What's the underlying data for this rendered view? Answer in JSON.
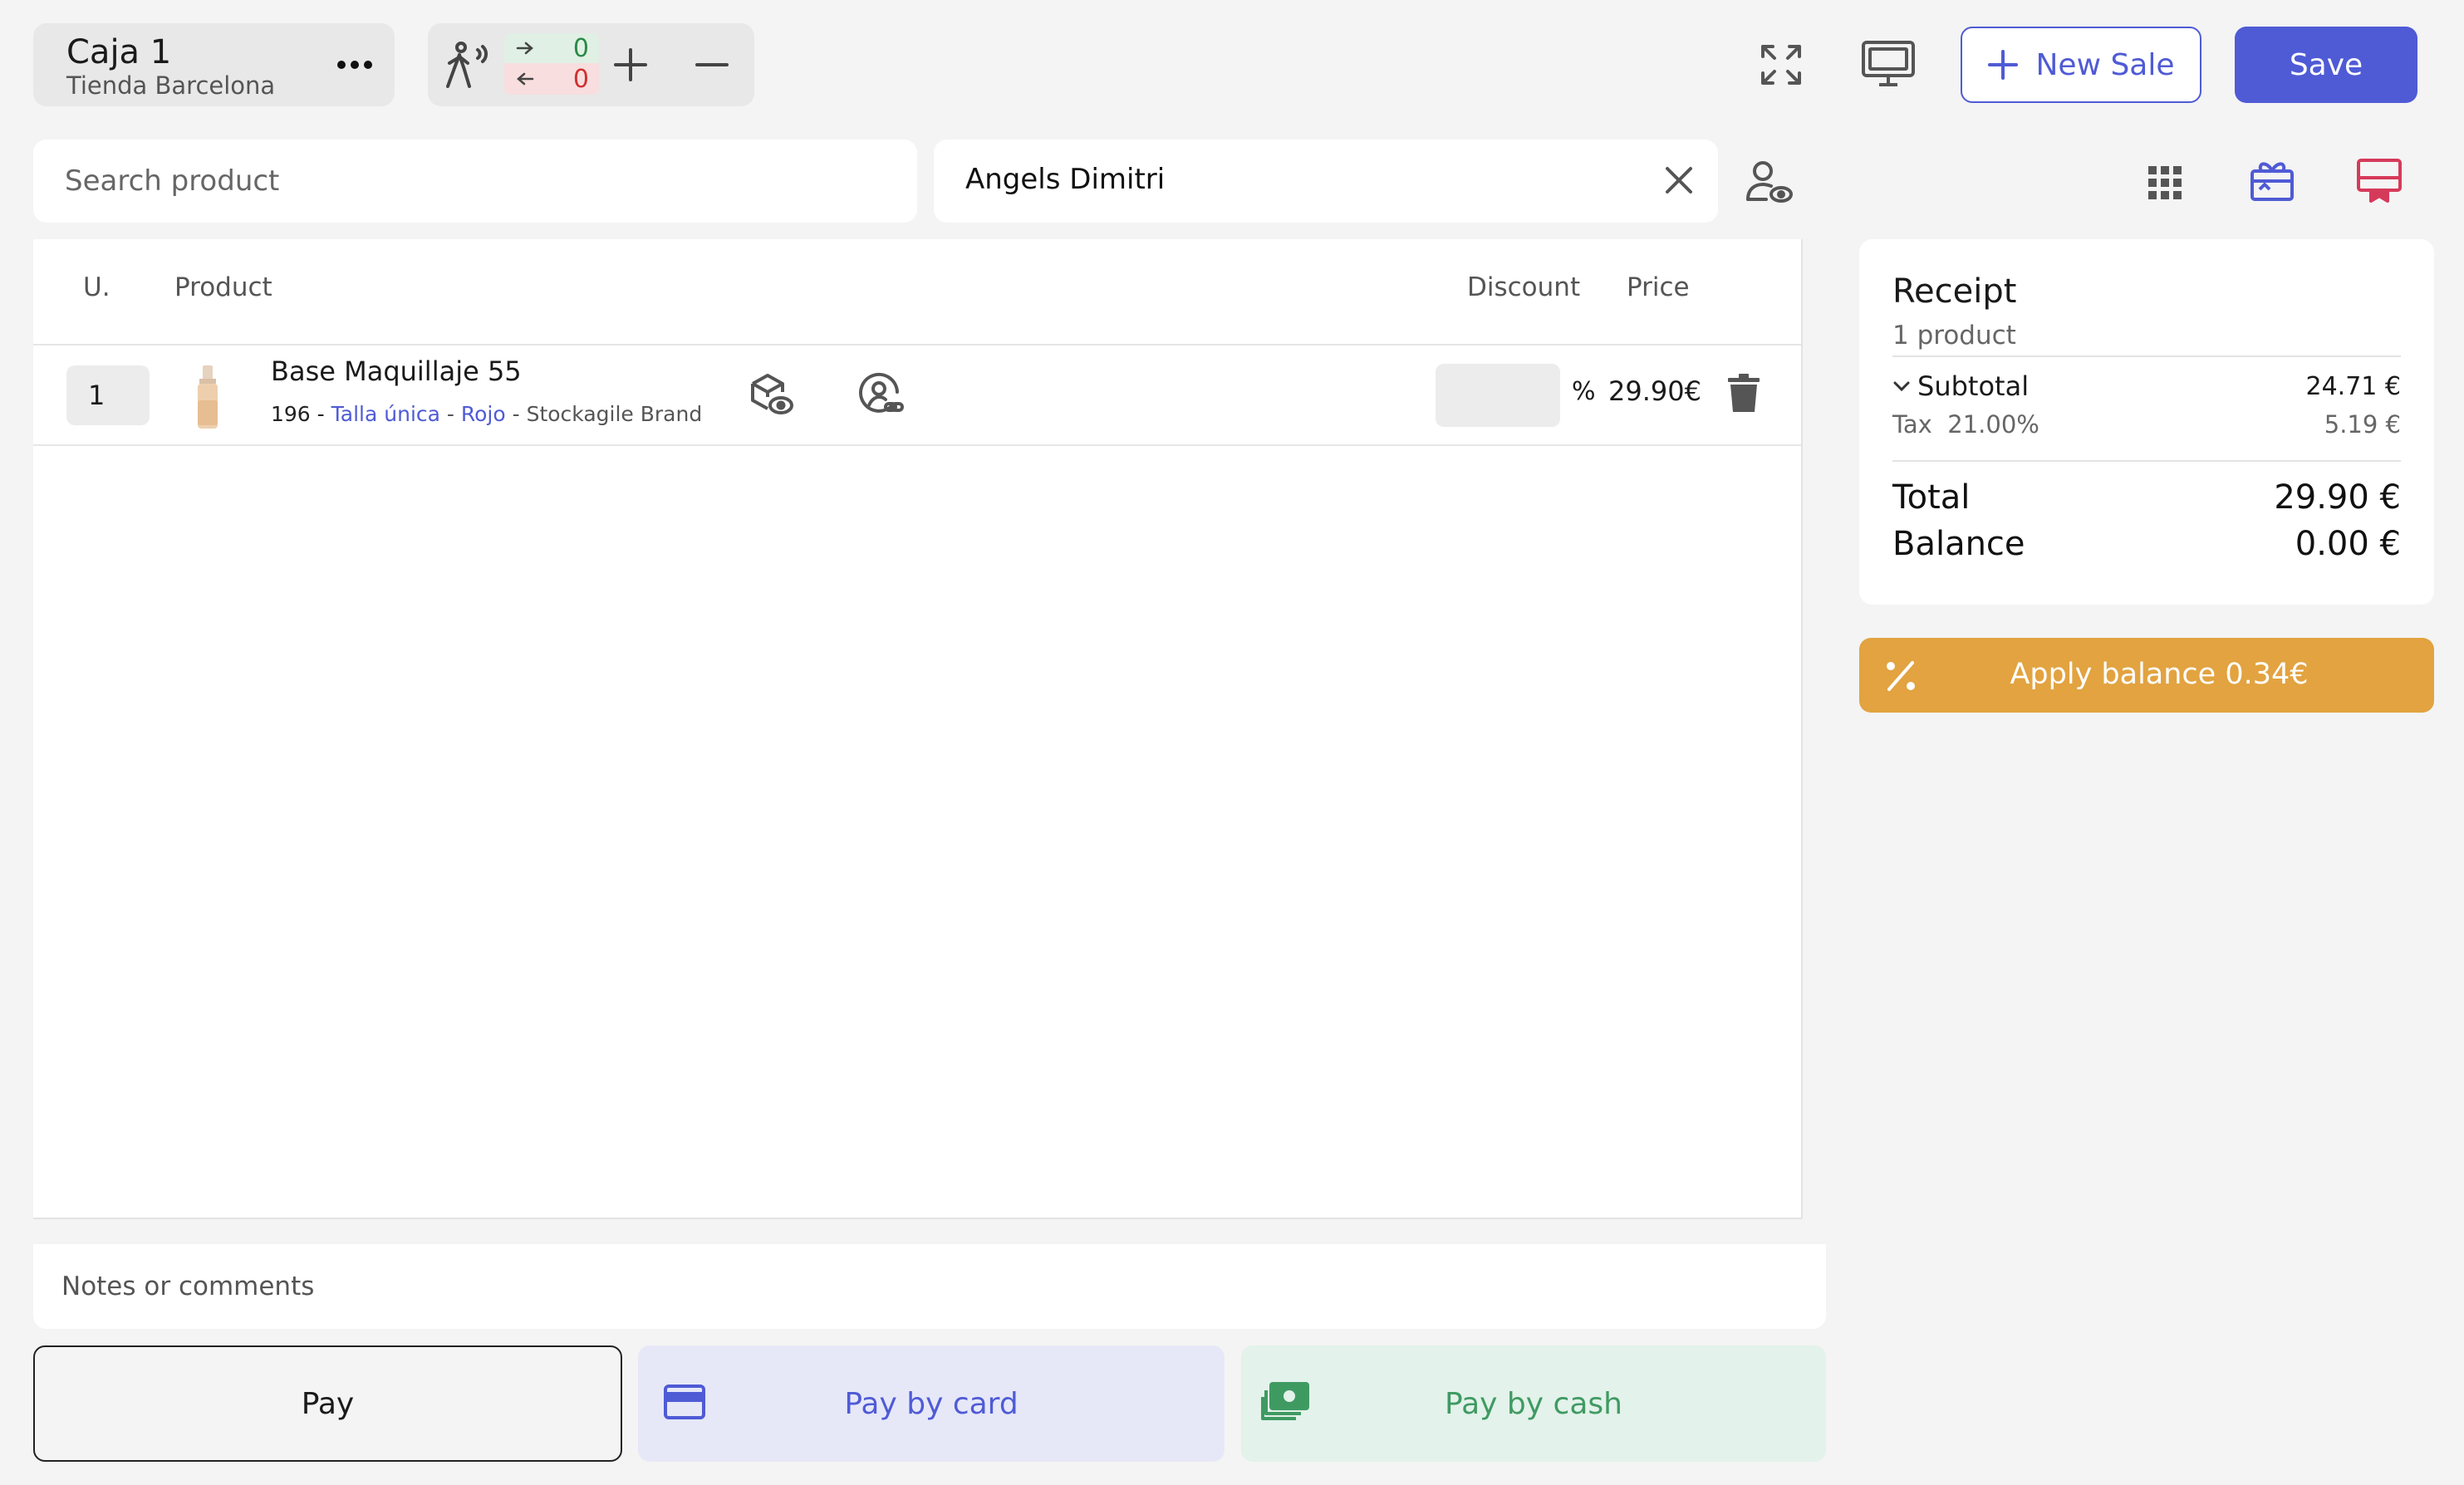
{
  "register": {
    "title": "Caja 1",
    "store": "Tienda Barcelona"
  },
  "traffic": {
    "in_count": "0",
    "out_count": "0"
  },
  "header": {
    "new_sale_label": "New Sale",
    "save_label": "Save"
  },
  "search": {
    "placeholder": "Search product",
    "value": ""
  },
  "customer": {
    "name": "Angels Dimitri"
  },
  "table": {
    "columns": {
      "units": "U.",
      "product": "Product",
      "discount": "Discount",
      "price": "Price"
    },
    "rows": [
      {
        "qty": "1",
        "name": "Base Maquillaje 55",
        "code": "196",
        "sep1": " - ",
        "size": "Talla única",
        "sep2": " - ",
        "color": "Rojo",
        "sep3": " - ",
        "brand": "Stockagile Brand",
        "discount": "",
        "percent_symbol": "%",
        "price": "29.90€"
      }
    ]
  },
  "notes": {
    "placeholder": "Notes or comments"
  },
  "payment": {
    "pay_label": "Pay",
    "card_label": "Pay by card",
    "cash_label": "Pay by cash"
  },
  "receipt": {
    "title": "Receipt",
    "count": "1 product",
    "subtotal_label": "Subtotal",
    "subtotal_value": "24.71 €",
    "tax_label": "Tax  21.00%",
    "tax_value": "5.19 €",
    "total_label": "Total",
    "total_value": "29.90 €",
    "balance_label": "Balance",
    "balance_value": "0.00 €"
  },
  "apply_balance": {
    "label": "Apply balance 0.34€"
  },
  "colors": {
    "primary": "#4f5bd5",
    "apply_balance": "#e2a340",
    "card_bg": "#e6e8f8",
    "cash_bg": "#e3f2ea",
    "receipt_icon": "#d63a5a"
  }
}
